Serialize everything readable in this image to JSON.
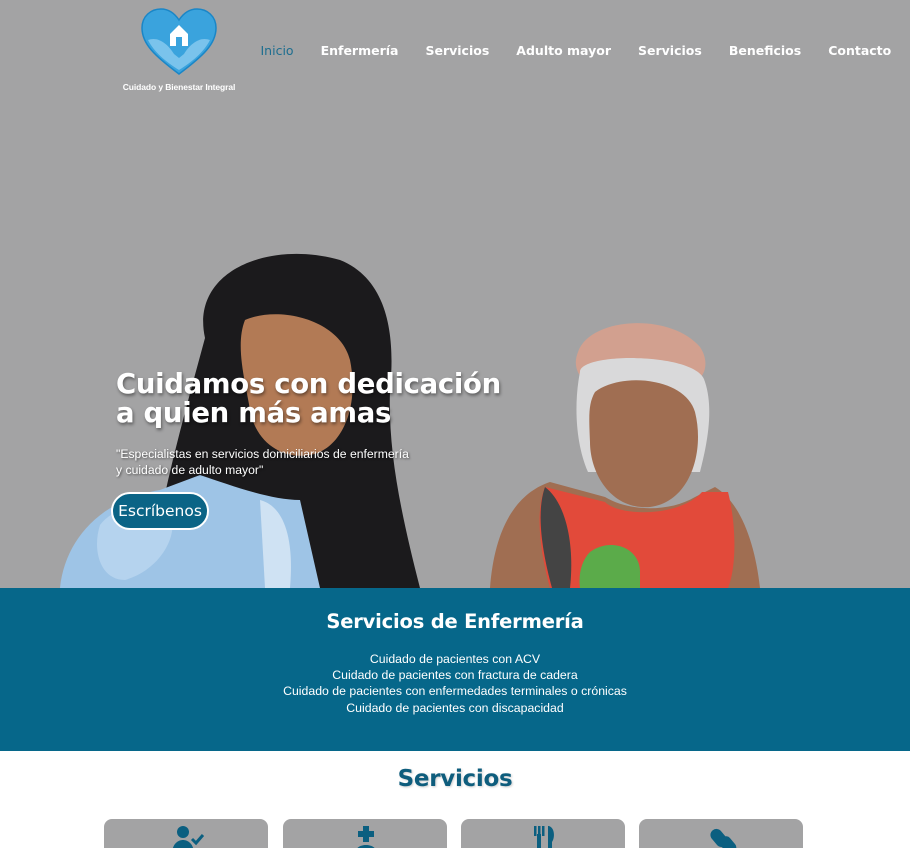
{
  "brand": {
    "tagline": "Cuidado y Bienestar Integral",
    "colors": {
      "primary": "#06678a",
      "heading": "#0e5d7d",
      "hero_bg": "#a3a3a4",
      "logo_blue": "#3aa3dd"
    }
  },
  "nav": {
    "items": [
      {
        "label": "Inicio",
        "active": true
      },
      {
        "label": "Enfermería",
        "active": false
      },
      {
        "label": "Servicios",
        "active": false
      },
      {
        "label": "Adulto mayor",
        "active": false
      },
      {
        "label": "Servicios",
        "active": false
      },
      {
        "label": "Beneficios",
        "active": false
      },
      {
        "label": "Contacto",
        "active": false
      }
    ]
  },
  "hero": {
    "headline_line1": "Cuidamos con dedicación",
    "headline_line2": "a quien más amas",
    "subtitle_line1": "\"Especialistas en servicios domiciliarios de enfermería",
    "subtitle_line2": "y cuidado de adulto mayor\"",
    "cta_label": "Escríbenos"
  },
  "nursing": {
    "title": "Servicios de Enfermería",
    "items": [
      "Cuidado de pacientes con ACV",
      "Cuidado de pacientes con fractura de cadera",
      "Cuidado de pacientes con enfermedades terminales o crónicas",
      "Cuidado de pacientes con discapacidad"
    ]
  },
  "services": {
    "title": "Servicios",
    "cards": [
      {
        "icon": "user-check-icon"
      },
      {
        "icon": "medical-cross-user-icon"
      },
      {
        "icon": "fork-knife-icon"
      },
      {
        "icon": "pill-bottle-icon"
      }
    ]
  }
}
